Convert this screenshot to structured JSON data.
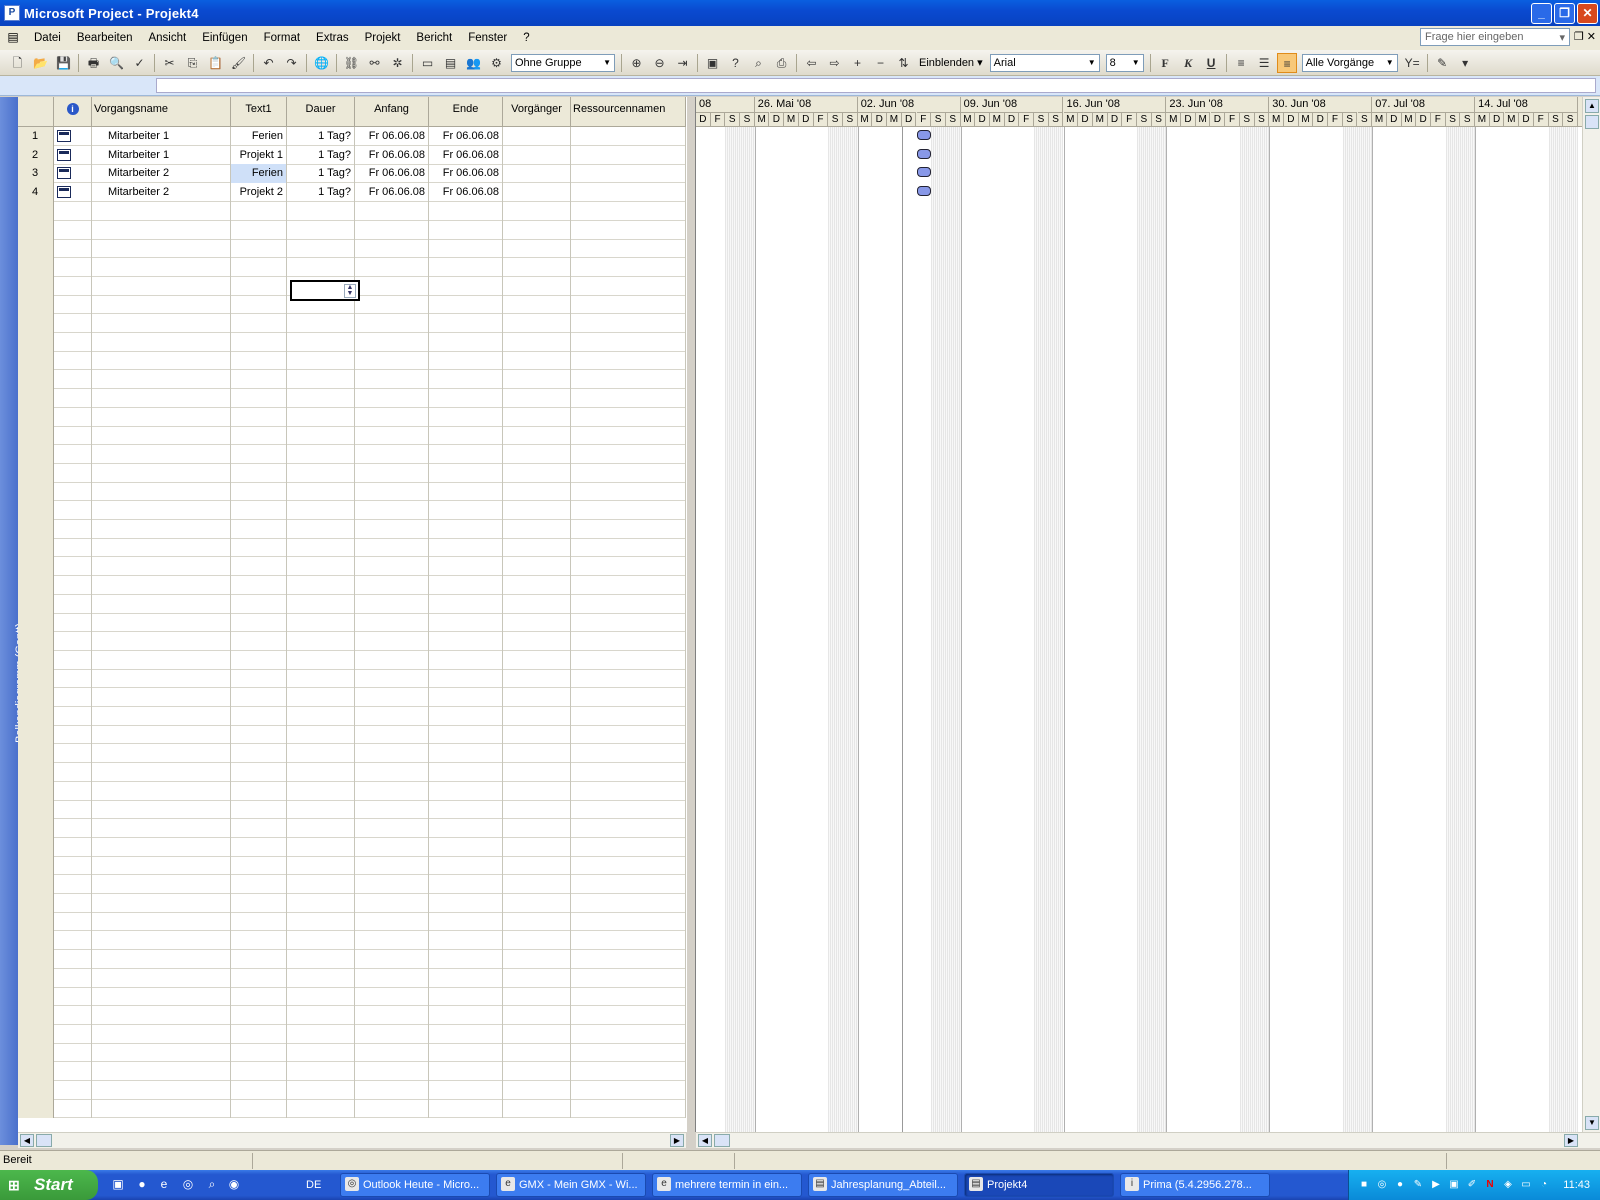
{
  "window": {
    "title": "Microsoft Project - Projekt4"
  },
  "menu": {
    "items": [
      "Datei",
      "Bearbeiten",
      "Ansicht",
      "Einfügen",
      "Format",
      "Extras",
      "Projekt",
      "Bericht",
      "Fenster",
      "?"
    ],
    "ask_placeholder": "Frage hier eingeben"
  },
  "toolbar": {
    "group_combo": "Ohne Gruppe",
    "show_label": "Einblenden",
    "font_combo": "Arial",
    "size_combo": "8",
    "bold": "F",
    "italic": "K",
    "underline": "U",
    "filter_combo": "Alle Vorgänge"
  },
  "view_bar": {
    "label": "Balkendiagramm (Gantt)"
  },
  "table": {
    "headers": {
      "info": "i",
      "name": "Vorgangsname",
      "text1": "Text1",
      "duration": "Dauer",
      "start": "Anfang",
      "end": "Ende",
      "pred": "Vorgänger",
      "resources": "Ressourcennamen"
    },
    "rows": [
      {
        "id": "1",
        "name": "Mitarbeiter 1",
        "text1": "Ferien",
        "duration": "1 Tag?",
        "start": "Fr 06.06.08",
        "end": "Fr 06.06.08",
        "pred": "",
        "resources": ""
      },
      {
        "id": "2",
        "name": "Mitarbeiter 1",
        "text1": "Projekt 1",
        "duration": "1 Tag?",
        "start": "Fr 06.06.08",
        "end": "Fr 06.06.08",
        "pred": "",
        "resources": ""
      },
      {
        "id": "3",
        "name": "Mitarbeiter 2",
        "text1": "Ferien",
        "duration": "1 Tag?",
        "start": "Fr 06.06.08",
        "end": "Fr 06.06.08",
        "pred": "",
        "resources": ""
      },
      {
        "id": "4",
        "name": "Mitarbeiter 2",
        "text1": "Projekt 2",
        "duration": "1 Tag?",
        "start": "Fr 06.06.08",
        "end": "Fr 06.06.08",
        "pred": "",
        "resources": ""
      }
    ]
  },
  "gantt": {
    "first_week_fragment": "08",
    "weeks": [
      "26. Mai '08",
      "02. Jun '08",
      "09. Jun '08",
      "16. Jun '08",
      "23. Jun '08",
      "30. Jun '08",
      "07. Jul '08",
      "14. Jul '08"
    ],
    "day_letters": [
      "M",
      "D",
      "M",
      "D",
      "F",
      "S",
      "S"
    ],
    "lead_days": [
      "D",
      "F",
      "S",
      "S"
    ]
  },
  "status": {
    "text": "Bereit"
  },
  "taskbar": {
    "start_label": "Start",
    "lang": "DE",
    "buttons": [
      "Outlook Heute - Micro...",
      "GMX - Mein GMX - Wi...",
      "mehrere termin in ein...",
      "Jahresplanung_Abteil...",
      "Projekt4",
      "Prima (5.4.2956.278..."
    ],
    "clock": "11:43"
  }
}
